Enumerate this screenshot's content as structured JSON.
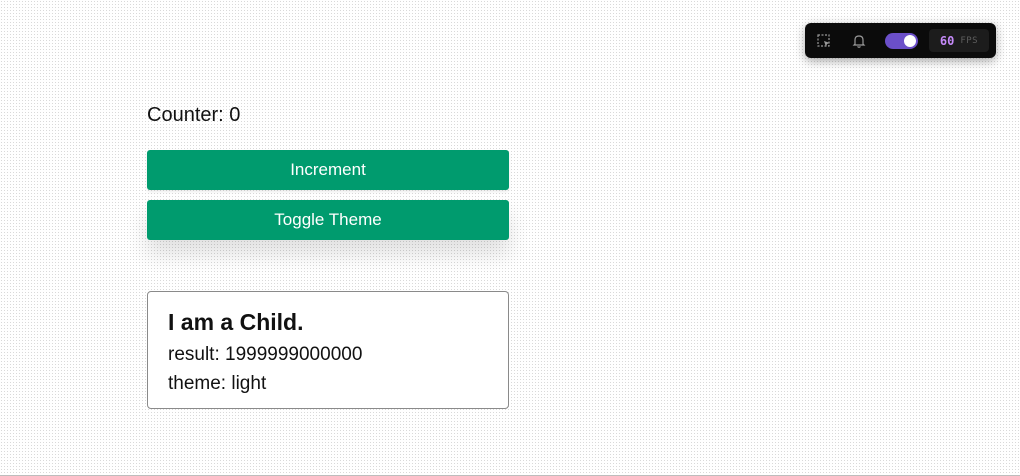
{
  "toolbar": {
    "icons": [
      "select-element-icon",
      "bell-icon"
    ],
    "toggle_on": true,
    "fps_value": "60",
    "fps_unit": "FPS",
    "accent_color": "#6b4fc9",
    "fps_color": "#c58af9"
  },
  "main": {
    "counter_label": "Counter: 0",
    "increment_label": "Increment",
    "toggle_theme_label": "Toggle Theme",
    "button_color": "#009b6e"
  },
  "child": {
    "title": "I am a Child.",
    "result_text": "result: 1999999000000",
    "theme_text": "theme: light"
  }
}
